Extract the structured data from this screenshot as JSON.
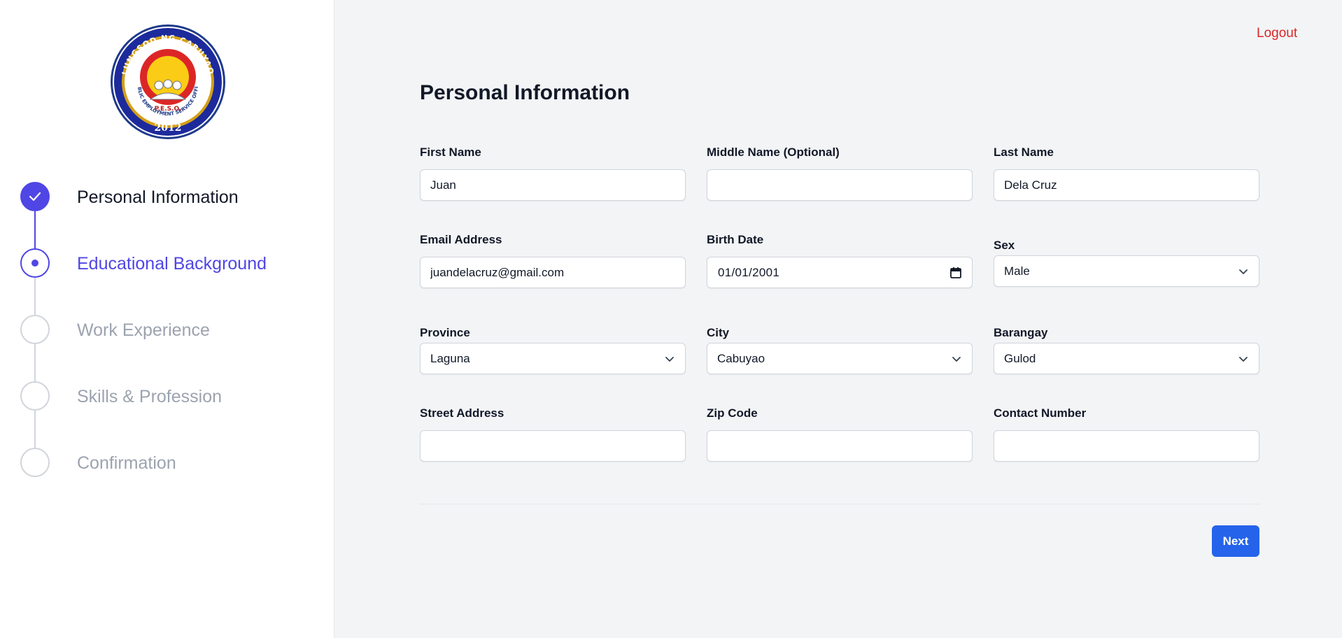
{
  "sidebar": {
    "logo": {
      "ring_text_top": "LUNGSOD NG CABUYAO",
      "inner_text": "PUBLIC EMPLOYMENT SERVICE OFFICE",
      "acronym": "P.E.S.O.",
      "year": "2012"
    },
    "steps": [
      {
        "label": "Personal Information",
        "state": "completed"
      },
      {
        "label": "Educational Background",
        "state": "current"
      },
      {
        "label": "Work Experience",
        "state": "upcoming"
      },
      {
        "label": "Skills & Profession",
        "state": "upcoming"
      },
      {
        "label": "Confirmation",
        "state": "upcoming"
      }
    ]
  },
  "header": {
    "logout_label": "Logout"
  },
  "form": {
    "title": "Personal Information",
    "first_name": {
      "label": "First Name",
      "value": "Juan"
    },
    "middle_name": {
      "label": "Middle Name (Optional)",
      "value": ""
    },
    "last_name": {
      "label": "Last Name",
      "value": "Dela Cruz"
    },
    "email": {
      "label": "Email Address",
      "value": "juandelacruz@gmail.com"
    },
    "birth_date": {
      "label": "Birth Date",
      "value": "01/01/2001"
    },
    "sex": {
      "label": "Sex",
      "value": "Male"
    },
    "province": {
      "label": "Province",
      "value": "Laguna"
    },
    "city": {
      "label": "City",
      "value": "Cabuyao"
    },
    "barangay": {
      "label": "Barangay",
      "value": "Gulod"
    },
    "street": {
      "label": "Street Address",
      "value": ""
    },
    "zip": {
      "label": "Zip Code",
      "value": ""
    },
    "contact": {
      "label": "Contact Number",
      "value": ""
    },
    "next_label": "Next"
  },
  "colors": {
    "accent": "#4f46e5",
    "primary_button": "#2563eb",
    "logout": "#dc2626",
    "muted": "#9ca3af"
  },
  "icons": [
    "checkmark-icon",
    "chevron-down-icon",
    "calendar-icon"
  ]
}
